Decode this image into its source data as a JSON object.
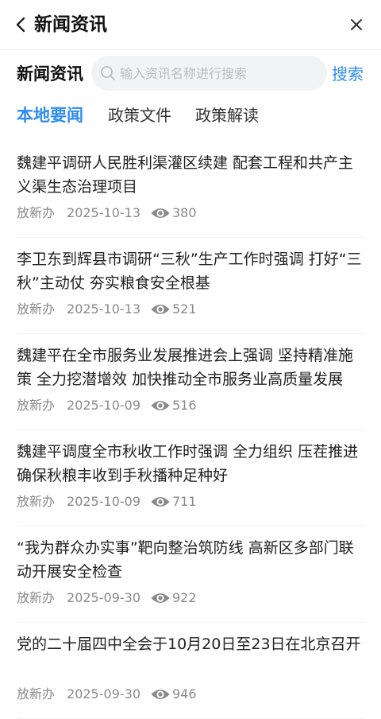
{
  "header": {
    "title": "新闻资讯"
  },
  "search": {
    "label": "新闻资讯",
    "placeholder": "输入资讯名称进行搜索",
    "button": "搜索"
  },
  "tabs": [
    {
      "label": "本地要闻",
      "active": true
    },
    {
      "label": "政策文件",
      "active": false
    },
    {
      "label": "政策解读",
      "active": false
    }
  ],
  "articles": [
    {
      "title": "魏建平调研人民胜利渠灌区续建 配套工程和共产主义渠生态治理项目",
      "source": "放新办",
      "date": "2025-10-13",
      "views": "380"
    },
    {
      "title": "李卫东到辉县市调研“三秋”生产工作时强调 打好“三秋”主动仗 夯实粮食安全根基",
      "source": "放新办",
      "date": "2025-10-13",
      "views": "521"
    },
    {
      "title": "魏建平在全市服务业发展推进会上强调 坚持精准施策 全力挖潜增效 加快推动全市服务业高质量发展",
      "source": "放新办",
      "date": "2025-10-09",
      "views": "516"
    },
    {
      "title": "魏建平调度全市秋收工作时强调 全力组织 压茬推进 确保秋粮丰收到手秋播种足种好",
      "source": "放新办",
      "date": "2025-10-09",
      "views": "711"
    },
    {
      "title": "“我为群众办实事”靶向整治筑防线 高新区多部门联动开展安全检查",
      "source": "放新办",
      "date": "2025-09-30",
      "views": "922"
    },
    {
      "title": "党的二十届四中全会于10月20日至23日在北京召开",
      "source": "放新办",
      "date": "2025-09-30",
      "views": "946"
    }
  ],
  "colors": {
    "accent": "#2d8cf0",
    "meta": "#8a8a8a"
  },
  "icons": [
    "back-arrow-icon",
    "close-icon",
    "search-icon",
    "eye-icon"
  ]
}
